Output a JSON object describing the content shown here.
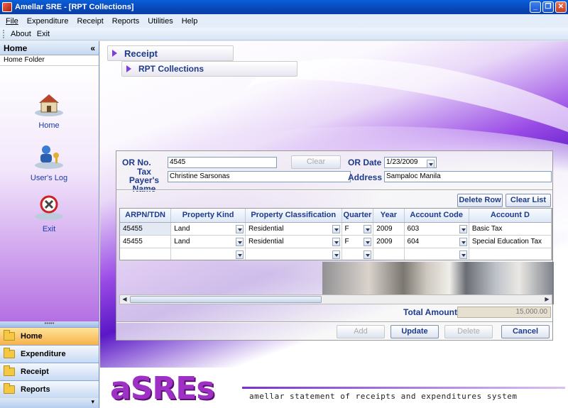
{
  "window": {
    "title": "Amellar SRE - [RPT Collections]",
    "minimize": "_",
    "restore": "❐",
    "close": "✕"
  },
  "menubar": {
    "items": [
      "File",
      "Expenditure",
      "Receipt",
      "Reports",
      "Utilities",
      "Help"
    ]
  },
  "toolbar": {
    "about": "About",
    "exit": "Exit"
  },
  "sidebar": {
    "header": "Home",
    "collapse_glyph": "«",
    "subheader": "Home Folder",
    "items": [
      {
        "label": "Home",
        "icon": "house-icon"
      },
      {
        "label": "User's Log",
        "icon": "user-key-icon"
      },
      {
        "label": "Exit",
        "icon": "exit-icon"
      }
    ],
    "handle": "•••••",
    "nav": [
      {
        "label": "Home",
        "active": true
      },
      {
        "label": "Expenditure",
        "active": false
      },
      {
        "label": "Receipt",
        "active": false
      },
      {
        "label": "Reports",
        "active": false
      }
    ],
    "bottom_glyph": "▾"
  },
  "breadcrumb": {
    "level1": "Receipt",
    "level2": "RPT Collections"
  },
  "form": {
    "or_no_label": "OR No.",
    "or_no_value": "4545",
    "clear_label": "Clear",
    "or_date_label": "OR Date",
    "or_date_value": "1/23/2009",
    "taxpayer_label_1": "Tax Payer's",
    "taxpayer_label_2": "Name",
    "taxpayer_value": "Christine Sarsonas",
    "address_label": "Address",
    "address_value": "Sampaloc Manila",
    "delete_row_label": "Delete Row",
    "clear_list_label": "Clear List",
    "total_label": "Total Amount",
    "total_value": "15,000.00",
    "add_label": "Add",
    "update_label": "Update",
    "delete_label": "Delete",
    "cancel_label": "Cancel"
  },
  "grid": {
    "columns": [
      "ARPN/TDN",
      "Property Kind",
      "Property Classification",
      "Quarter",
      "Year",
      "Account Code",
      "Account D"
    ],
    "rows": [
      [
        "45455",
        "Land",
        "Residential",
        "F",
        "2009",
        "603",
        "Basic Tax"
      ],
      [
        "45455",
        "Land",
        "Residential",
        "F",
        "2009",
        "604",
        "Special Education Tax"
      ],
      [
        "",
        "",
        "",
        "",
        "",
        "",
        ""
      ]
    ]
  },
  "branding": {
    "logo": "aSREs",
    "tagline": "amellar statement of receipts and expenditures system"
  },
  "colors": {
    "accent": "#1d3a8c",
    "brand": "#9f30c6",
    "titlebar": "#0a5fd8",
    "active_nav": "#f7b14a"
  }
}
